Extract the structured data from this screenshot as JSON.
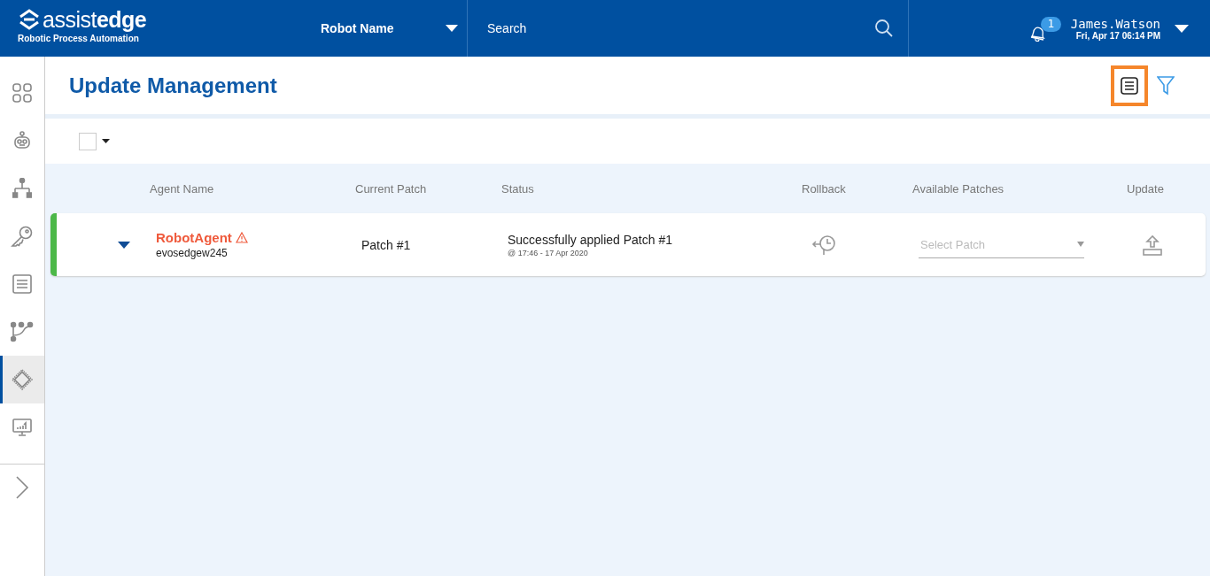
{
  "header": {
    "logo": "assist**edge**",
    "tagline": "Robotic Process Automation",
    "robot_select": "Robot Name",
    "search": {
      "placeholder": "Search"
    },
    "notifications": "1",
    "user": "James.Watson",
    "datetime": "Fri, Apr 17 06:14 PM"
  },
  "sidebar": {
    "items": [
      {
        "kind": "grid",
        "selected": false
      },
      {
        "kind": "robot",
        "selected": false
      },
      {
        "kind": "hierarchy",
        "selected": false
      },
      {
        "kind": "key",
        "selected": false
      },
      {
        "kind": "list",
        "selected": false
      },
      {
        "kind": "flow",
        "selected": false
      },
      {
        "kind": "chip",
        "selected": true
      },
      {
        "kind": "monitor",
        "selected": false
      }
    ]
  },
  "page": {
    "title": "Update Management",
    "select_all": {
      "checked": false
    }
  },
  "table": {
    "columns": [
      "Agent Name",
      "Current Patch",
      "Status",
      "Rollback",
      "Available Patches",
      "Update"
    ],
    "rows": [
      {
        "agent": "RobotAgent",
        "warning": true,
        "host": "evosedgew245",
        "patch": "Patch #1",
        "status": "Successfully applied Patch #1",
        "status_time": "@ 17:46 - 17 Apr 2020",
        "color": "#4cb848",
        "patch_select": {
          "placeholder": "Select Patch"
        }
      }
    ]
  }
}
